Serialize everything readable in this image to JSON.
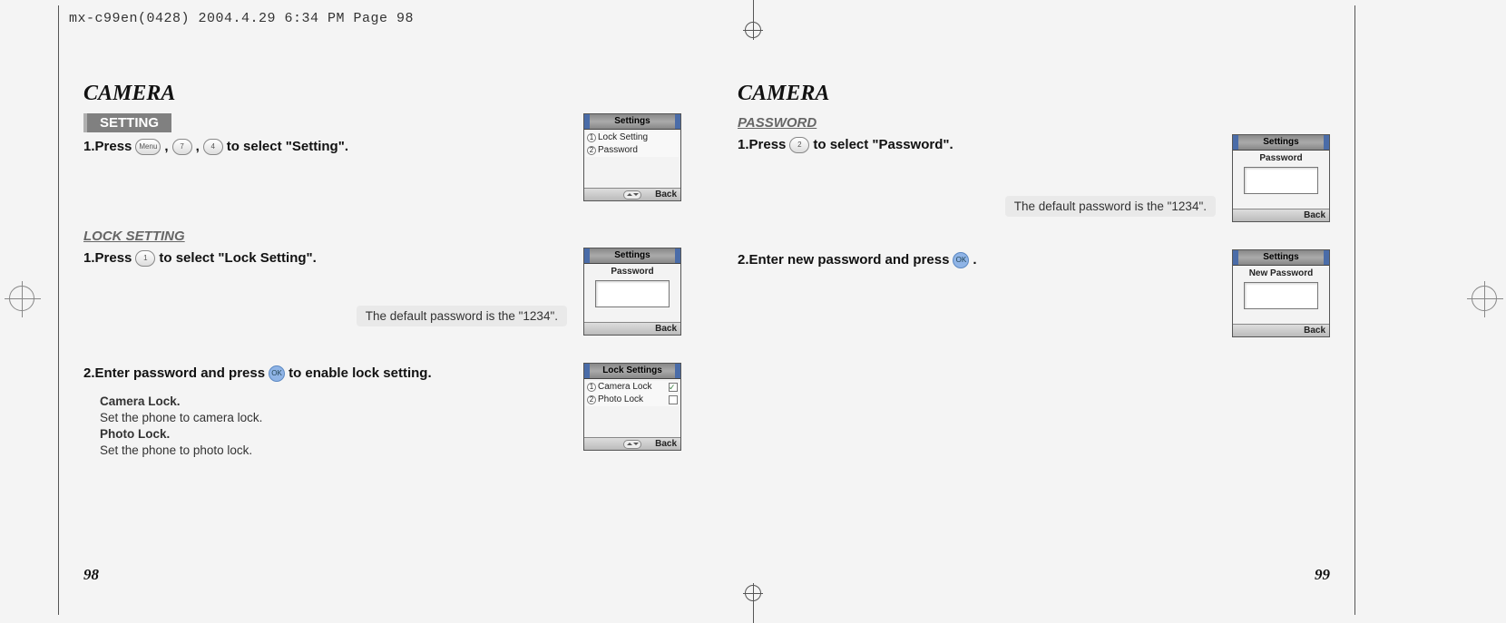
{
  "slug": "mx-c99en(0428)  2004.4.29  6:34 PM  Page 98",
  "left": {
    "title": "CAMERA",
    "sectionTab": "SETTING",
    "step1": {
      "pre": "1.Press",
      "keys": [
        "Menu",
        "7",
        "4"
      ],
      "post": "to select \"Setting\"."
    },
    "phone1": {
      "title": "Settings",
      "items": [
        "Lock Setting",
        "Password"
      ],
      "back": "Back"
    },
    "subLock": "LOCK SETTING",
    "lockStep1": {
      "pre": "1.Press",
      "key": "1",
      "post": "to select \"Lock Setting\"."
    },
    "phone2": {
      "title": "Settings",
      "subtitle": "Password",
      "back": "Back"
    },
    "note": "The default password is the \"1234\".",
    "lockStep2": {
      "pre": "2.Enter password and press",
      "key": "OK",
      "post": "to enable lock setting."
    },
    "desc": {
      "camTitle": "Camera Lock.",
      "camText": "Set the phone to camera lock.",
      "photoTitle": "Photo Lock.",
      "photoText": "Set the phone to photo lock."
    },
    "phone3": {
      "title": "Lock Settings",
      "items": [
        "Camera Lock",
        "Photo Lock"
      ],
      "back": "Back"
    },
    "pageNum": "98"
  },
  "right": {
    "title": "CAMERA",
    "subPassword": "PASSWORD",
    "pwStep1": {
      "pre": "1.Press",
      "key": "2",
      "post": "to select \"Password\"."
    },
    "phone1": {
      "title": "Settings",
      "subtitle": "Password",
      "back": "Back"
    },
    "note": "The default password is the \"1234\".",
    "pwStep2": {
      "pre": "2.Enter new password and press",
      "key": "OK",
      "post": "."
    },
    "phone2": {
      "title": "Settings",
      "subtitle": "New Password",
      "back": "Back"
    },
    "pageNum": "99"
  }
}
